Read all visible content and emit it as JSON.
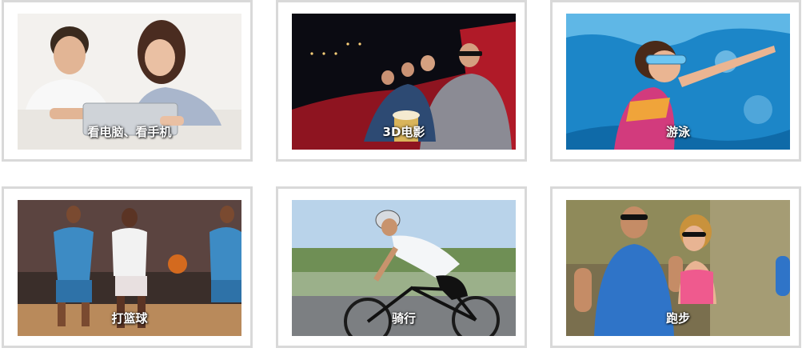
{
  "cards": [
    {
      "caption": "看电脑、看手机"
    },
    {
      "caption": "3D电影"
    },
    {
      "caption": "游泳"
    },
    {
      "caption": "打篮球"
    },
    {
      "caption": "骑行"
    },
    {
      "caption": "跑步"
    }
  ]
}
